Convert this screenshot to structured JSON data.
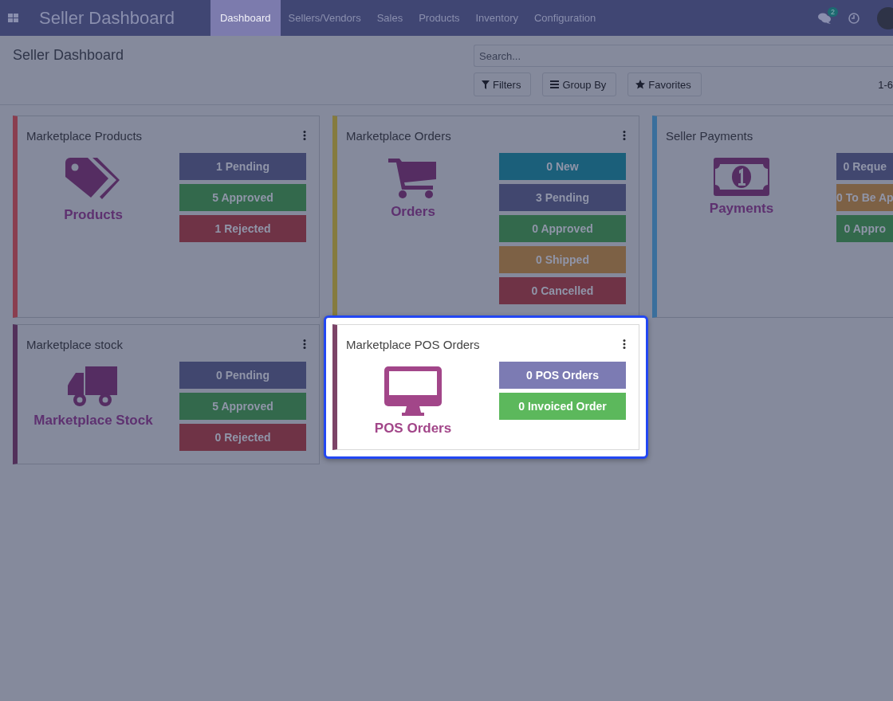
{
  "navbar": {
    "app_title": "Seller Dashboard",
    "menu": [
      {
        "label": "Dashboard",
        "selected": true
      },
      {
        "label": "Sellers/Vendors",
        "selected": false
      },
      {
        "label": "Sales",
        "selected": false
      },
      {
        "label": "Products",
        "selected": false
      },
      {
        "label": "Inventory",
        "selected": false
      },
      {
        "label": "Configuration",
        "selected": false
      }
    ],
    "messages_badge": "2"
  },
  "control_panel": {
    "breadcrumb": "Seller Dashboard",
    "search": {
      "placeholder": "Search..."
    },
    "buttons": [
      {
        "kind": "filter",
        "label": "Filters"
      },
      {
        "kind": "group",
        "label": "Group By"
      },
      {
        "kind": "star",
        "label": "Favorites"
      }
    ],
    "pager": "1-6"
  },
  "cards": [
    {
      "title": "Marketplace Products",
      "kind": "tags",
      "label": "Products",
      "color": "#8a3e4f",
      "highlighted": false,
      "buttons": [
        {
          "label": "1 Pending",
          "color": "#41476f"
        },
        {
          "label": "5 Approved",
          "color": "#33694c"
        },
        {
          "label": "1 Rejected",
          "color": "#6f3346"
        }
      ]
    },
    {
      "title": "Marketplace Orders",
      "kind": "cart",
      "label": "Orders",
      "color": "#857b3e",
      "highlighted": false,
      "buttons": [
        {
          "label": "0 New",
          "color": "#1b5f7a"
        },
        {
          "label": "3 Pending",
          "color": "#41476f"
        },
        {
          "label": "0 Approved",
          "color": "#33694c"
        },
        {
          "label": "0 Shipped",
          "color": "#7d6145"
        },
        {
          "label": "0 Cancelled",
          "color": "#6f3346"
        }
      ]
    },
    {
      "title": "Seller Payments",
      "kind": "money",
      "label": "Payments",
      "color": "#3a6f9c",
      "highlighted": false,
      "buttons": [
        {
          "label": "0 Reque",
          "color": "#41476f"
        },
        {
          "label": "0 To Be Ap",
          "color": "#7d6145"
        },
        {
          "label": "0 Appro",
          "color": "#33694c"
        }
      ]
    },
    {
      "title": "Marketplace stock",
      "kind": "truck",
      "label": "Marketplace Stock",
      "color": "#52305a",
      "highlighted": false,
      "buttons": [
        {
          "label": "0 Pending",
          "color": "#41476f"
        },
        {
          "label": "5 Approved",
          "color": "#33694c"
        },
        {
          "label": "0 Rejected",
          "color": "#6f3346"
        }
      ]
    },
    {
      "title": "Marketplace POS Orders",
      "kind": "monitor",
      "label": "POS Orders",
      "color": "#7c4468",
      "highlighted": true,
      "buttons": [
        {
          "label": "0 POS Orders",
          "color": "#7c7bb3"
        },
        {
          "label": "0 Invoiced Order",
          "color": "#5cb85c"
        }
      ]
    }
  ]
}
